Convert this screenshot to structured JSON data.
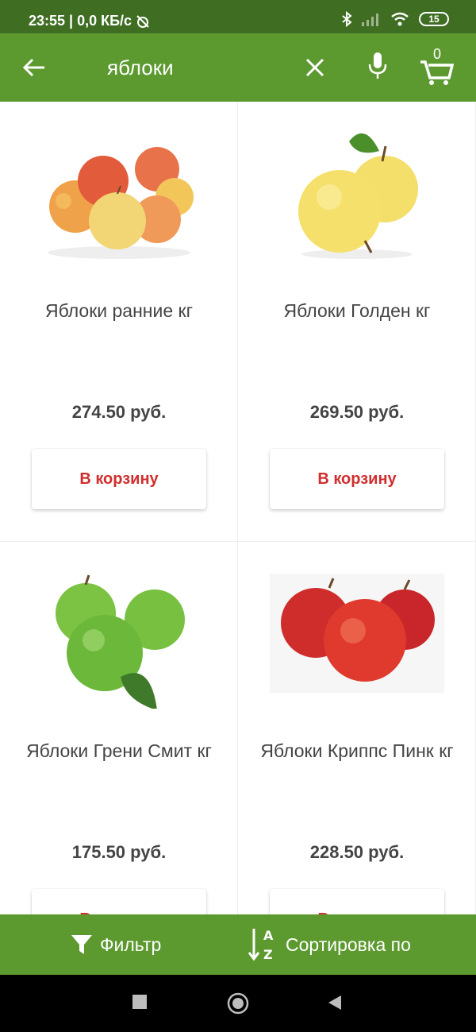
{
  "status_bar": {
    "time_speed": "23:55 | 0,0 КБ/с",
    "battery": "15"
  },
  "app_bar": {
    "search_query": "яблоки",
    "cart_count": "0",
    "icons": [
      "back-arrow-icon",
      "close-icon",
      "microphone-icon",
      "cart-icon"
    ]
  },
  "products": [
    {
      "name": "Яблоки ранние кг",
      "price": "274.50 руб.",
      "button": "В корзину"
    },
    {
      "name": "Яблоки Голден кг",
      "price": "269.50 руб.",
      "button": "В корзину"
    },
    {
      "name": "Яблоки Грени Смит кг",
      "price": "175.50 руб.",
      "button": "В корзину"
    },
    {
      "name": "Яблоки Криппс Пинк кг",
      "price": "228.50 руб.",
      "button": "В корзину"
    }
  ],
  "bottom_bar": {
    "filter_label": "Фильтр",
    "sort_label": "Сортировка по"
  },
  "colors": {
    "app_bar": "#5c9a30",
    "status_bar": "#3f6e23",
    "button_text": "#d12e2e"
  }
}
